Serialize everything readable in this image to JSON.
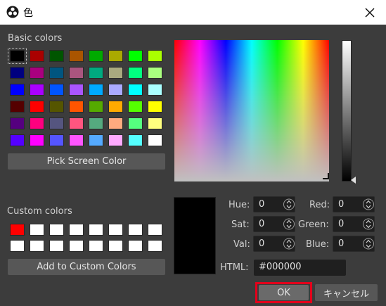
{
  "window": {
    "title": "色",
    "close_icon": "close-icon"
  },
  "basic_colors": {
    "label": "Basic colors",
    "swatches": [
      [
        "#000000",
        "#aa0000",
        "#005500",
        "#aa5500",
        "#00aa00",
        "#aaaa00",
        "#00ff00",
        "#aaff00"
      ],
      [
        "#00007f",
        "#aa007f",
        "#00557f",
        "#aa557f",
        "#00aa7f",
        "#aaaa7f",
        "#00ff7f",
        "#aaff7f"
      ],
      [
        "#0000ff",
        "#aa00ff",
        "#0055ff",
        "#aa55ff",
        "#00aaff",
        "#aaaaff",
        "#00ffff",
        "#aaffff"
      ],
      [
        "#550000",
        "#ff0000",
        "#555500",
        "#ff5500",
        "#55aa00",
        "#ffaa00",
        "#55ff00",
        "#ffff00"
      ],
      [
        "#55007f",
        "#ff007f",
        "#55557f",
        "#ff557f",
        "#55aa7f",
        "#ffaa7f",
        "#55ff7f",
        "#ffff7f"
      ],
      [
        "#5500ff",
        "#ff00ff",
        "#5555ff",
        "#ff55ff",
        "#55aaff",
        "#ffaaff",
        "#55ffff",
        "#ffffff"
      ]
    ],
    "selected_index": 0
  },
  "pick_screen_color": {
    "label": "Pick Screen Color"
  },
  "custom_colors": {
    "label": "Custom colors",
    "swatches": [
      [
        "#ff0000",
        "#ffffff",
        "#ffffff",
        "#ffffff",
        "#ffffff",
        "#ffffff",
        "#ffffff",
        "#ffffff"
      ],
      [
        "#ffffff",
        "#ffffff",
        "#ffffff",
        "#ffffff",
        "#ffffff",
        "#ffffff",
        "#ffffff",
        "#ffffff"
      ]
    ]
  },
  "add_custom": {
    "label": "Add to Custom Colors"
  },
  "fields": {
    "hue": {
      "label": "Hue:",
      "value": "0"
    },
    "sat": {
      "label": "Sat:",
      "value": "0"
    },
    "val": {
      "label": "Val:",
      "value": "0"
    },
    "red": {
      "label": "Red:",
      "value": "0"
    },
    "green": {
      "label": "Green:",
      "value": "0"
    },
    "blue": {
      "label": "Blue:",
      "value": "0"
    },
    "html": {
      "label": "HTML:",
      "value": "#000000"
    }
  },
  "buttons": {
    "ok": "OK",
    "cancel": "キャンセル"
  },
  "colors": {
    "highlight": "#e4001b",
    "background": "#3c3c3c",
    "current_color": "#000000"
  }
}
